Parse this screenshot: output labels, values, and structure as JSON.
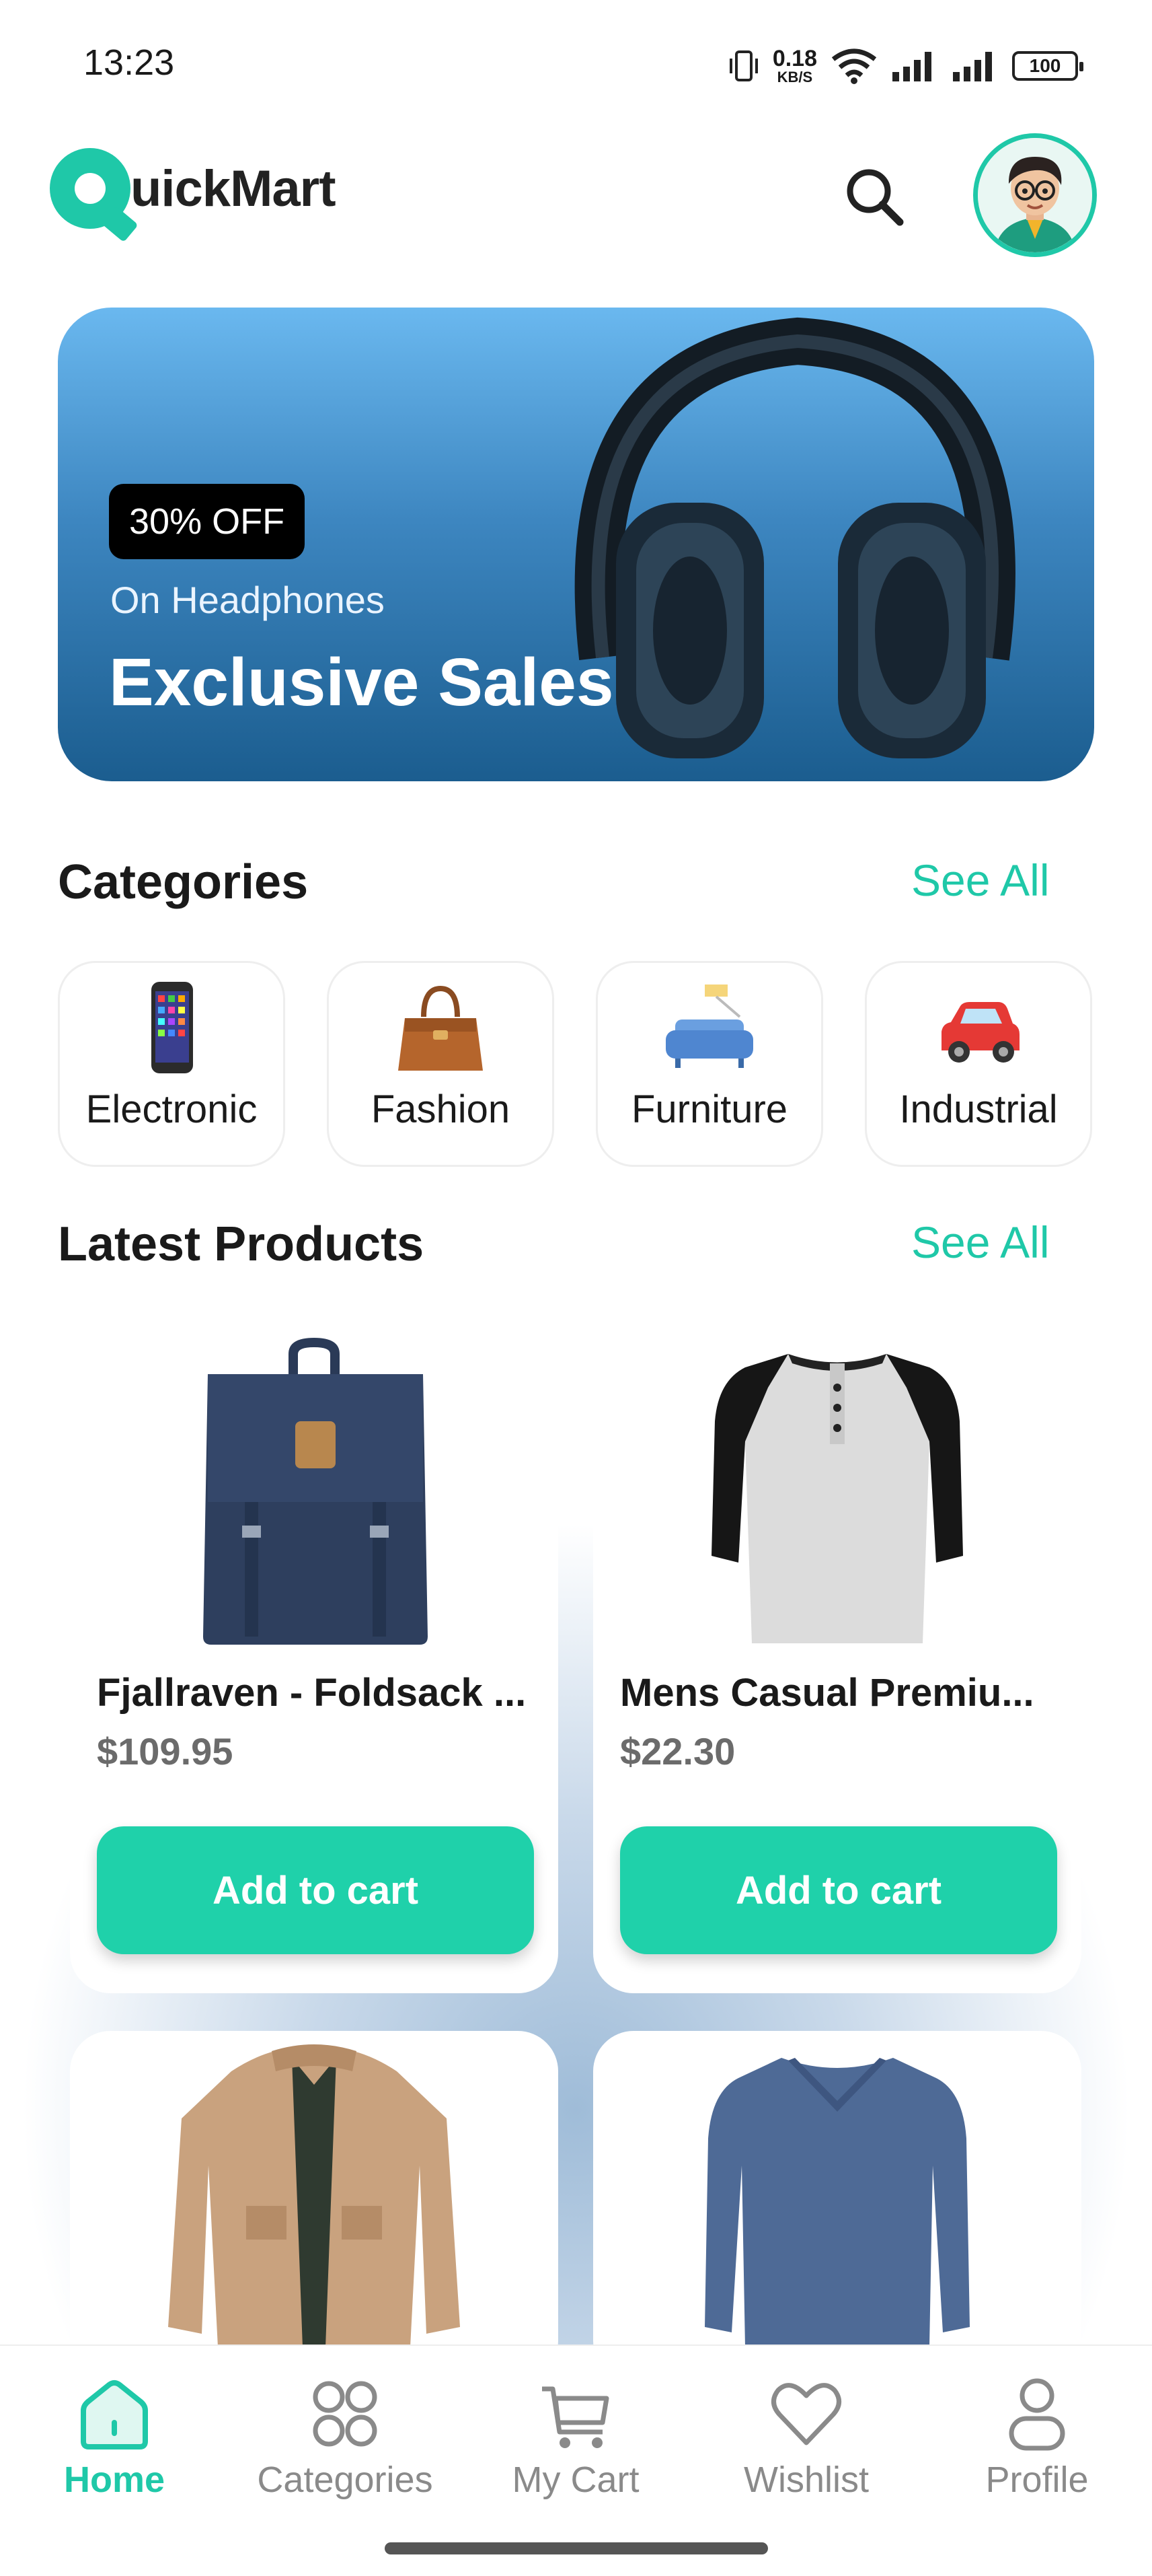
{
  "status_bar": {
    "time": "13:23",
    "net_speed_value": "0.18",
    "net_speed_unit": "KB/S",
    "battery": "100"
  },
  "header": {
    "logo_letter": "Q",
    "logo_text": "uickMart",
    "search_icon": "search-icon",
    "avatar_icon": "avatar-icon"
  },
  "banner": {
    "badge": "30% OFF",
    "subtitle": "On Headphones",
    "title": "Exclusive Sales",
    "image": "headphones-image"
  },
  "categories": {
    "title": "Categories",
    "see_all": "See All",
    "items": [
      {
        "label": "Electronic",
        "icon": "mobile-phone-icon"
      },
      {
        "label": "Fashion",
        "icon": "handbag-icon"
      },
      {
        "label": "Furniture",
        "icon": "sofa-icon"
      },
      {
        "label": "Industrial",
        "icon": "car-icon"
      }
    ]
  },
  "latest_products": {
    "title": "Latest Products",
    "see_all": "See All",
    "add_to_cart_label": "Add to cart",
    "items": [
      {
        "name": "Fjallraven - Foldsack ...",
        "price": "$109.95",
        "image": "backpack-image"
      },
      {
        "name": "Mens Casual Premiu...",
        "price": "$22.30",
        "image": "raglan-shirt-image"
      },
      {
        "name": "",
        "price": "",
        "image": "jacket-image"
      },
      {
        "name": "",
        "price": "",
        "image": "long-sleeve-shirt-image"
      }
    ]
  },
  "bottom_nav": {
    "items": [
      {
        "label": "Home",
        "icon": "home-icon",
        "active": true
      },
      {
        "label": "Categories",
        "icon": "grid-icon",
        "active": false
      },
      {
        "label": "My Cart",
        "icon": "cart-icon",
        "active": false
      },
      {
        "label": "Wishlist",
        "icon": "heart-icon",
        "active": false
      },
      {
        "label": "Profile",
        "icon": "user-icon",
        "active": false
      }
    ]
  },
  "colors": {
    "accent": "#1fc8a8",
    "button": "#1fd1aa",
    "banner_top": "#6ab8ef",
    "banner_bottom": "#1b5d8f"
  }
}
